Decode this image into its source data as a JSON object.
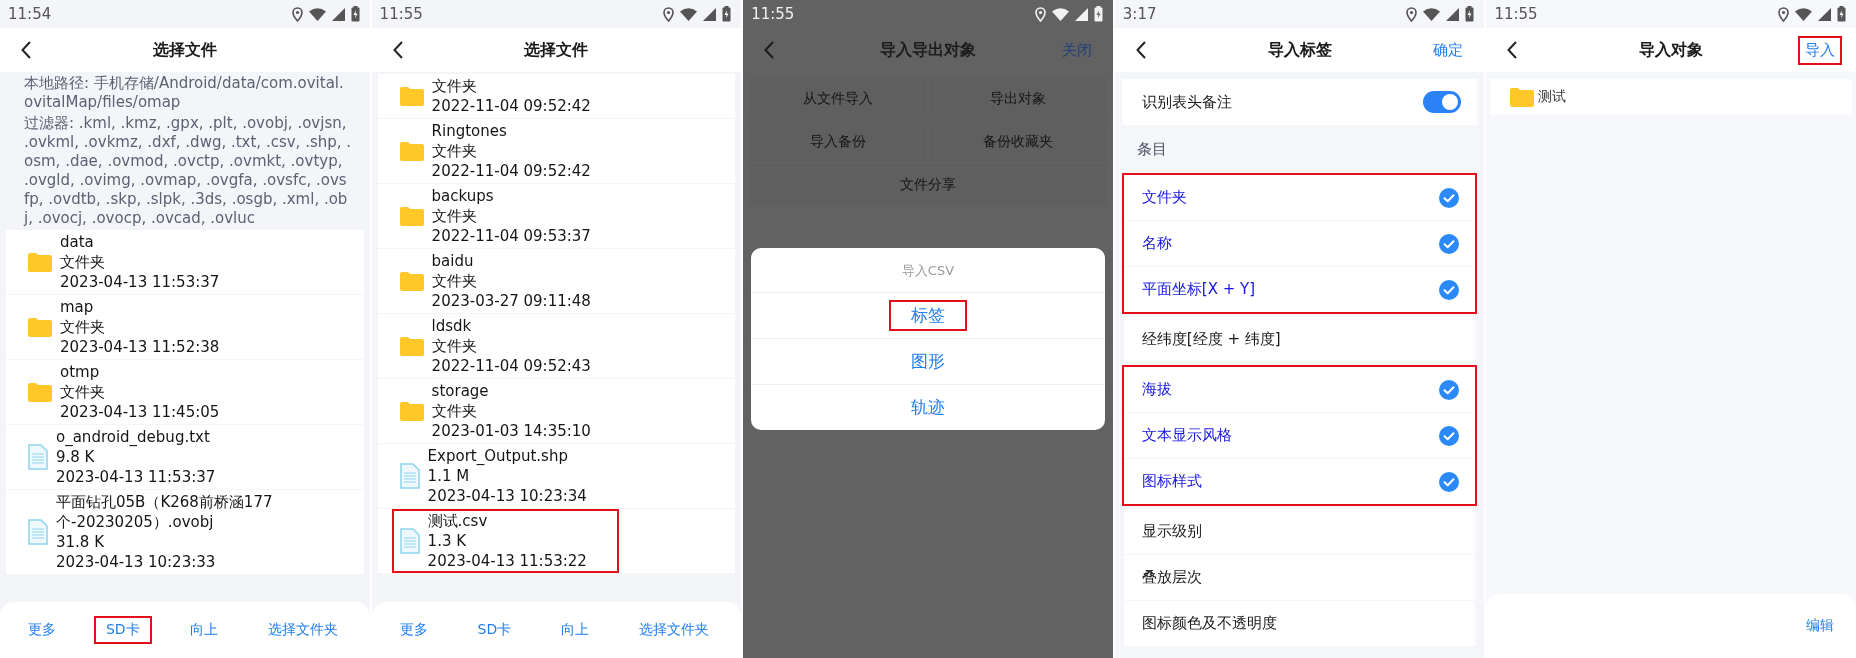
{
  "screens": [
    {
      "kind": "file_picker",
      "status_bar": {
        "time": "11:54"
      },
      "title": "选择文件",
      "path_info": "本地路径: 手机存储/Android/data/com.ovital.ovitalMap/files/omap",
      "filter_info": "过滤器: .kml, .kmz, .gpx, .plt, .ovobj, .ovjsn, .ovkml, .ovkmz, .dxf, .dwg, .txt, .csv, .shp, .osm, .dae, .ovmod, .ovctp, .ovmkt, .ovtyp, .ovgld, .ovimg, .ovmap, .ovgfa, .ovsfc, .ovsfp, .ovdtb, .skp, .slpk, .3ds, .osgb, .xml, .obj, .ovocj, .ovocp, .ovcad, .ovluc",
      "files": [
        {
          "kind": "folder",
          "name": "data",
          "detail": "文件夹",
          "date": "2023-04-13 11:53:37",
          "highlighted": false
        },
        {
          "kind": "folder",
          "name": "map",
          "detail": "文件夹",
          "date": "2023-04-13 11:52:38",
          "highlighted": false
        },
        {
          "kind": "folder",
          "name": "otmp",
          "detail": "文件夹",
          "date": "2023-04-13 11:45:05",
          "highlighted": false
        },
        {
          "kind": "file",
          "name": "o_android_debug.txt",
          "detail": "9.8 K",
          "date": "2023-04-13 11:53:37",
          "highlighted": false
        },
        {
          "kind": "file",
          "name": "平面钻孔05B（K268前桥涵177个-20230205）.ovobj",
          "detail": "31.8 K",
          "date": "2023-04-13 10:23:33",
          "highlighted": false
        }
      ],
      "toolbar": [
        {
          "label": "更多",
          "highlighted": false
        },
        {
          "label": "SD卡",
          "highlighted": true
        },
        {
          "label": "向上",
          "highlighted": false
        },
        {
          "label": "选择文件夹",
          "highlighted": false
        }
      ]
    },
    {
      "kind": "file_picker",
      "status_bar": {
        "time": "11:55"
      },
      "title": "选择文件",
      "files": [
        {
          "kind": "folder",
          "detail": "文件夹",
          "date": "2022-11-04 09:52:42",
          "highlighted": false
        },
        {
          "kind": "folder",
          "name": "Ringtones",
          "detail": "文件夹",
          "date": "2022-11-04 09:52:42",
          "highlighted": false
        },
        {
          "kind": "folder",
          "name": "backups",
          "detail": "文件夹",
          "date": "2022-11-04 09:53:37",
          "highlighted": false
        },
        {
          "kind": "folder",
          "name": "baidu",
          "detail": "文件夹",
          "date": "2023-03-27 09:11:48",
          "highlighted": false
        },
        {
          "kind": "folder",
          "name": "ldsdk",
          "detail": "文件夹",
          "date": "2022-11-04 09:52:43",
          "highlighted": false
        },
        {
          "kind": "folder",
          "name": "storage",
          "detail": "文件夹",
          "date": "2023-01-03 14:35:10",
          "highlighted": false
        },
        {
          "kind": "file",
          "name": "Export_Output.shp",
          "detail": "1.1 M",
          "date": "2023-04-13 10:23:34",
          "highlighted": false
        },
        {
          "kind": "file",
          "name": "测试.csv",
          "detail": "1.3 K",
          "date": "2023-04-13 11:53:22",
          "highlighted": true
        }
      ],
      "toolbar": [
        {
          "label": "更多",
          "highlighted": false
        },
        {
          "label": "SD卡",
          "highlighted": false
        },
        {
          "label": "向上",
          "highlighted": false
        },
        {
          "label": "选择文件夹",
          "highlighted": false
        }
      ]
    },
    {
      "kind": "action_dialog",
      "status_bar": {
        "time": "11:55"
      },
      "title": "导入导出对象",
      "close_label": "关闭",
      "actions": [
        "从文件导入",
        "导出对象",
        "导入备份",
        "备份收藏夹",
        "文件分享"
      ],
      "dialog": {
        "title": "导入CSV",
        "options": [
          {
            "label": "标签",
            "highlighted": true
          },
          {
            "label": "图形",
            "highlighted": false
          },
          {
            "label": "轨迹",
            "highlighted": false
          }
        ]
      }
    },
    {
      "kind": "field_selector",
      "status_bar": {
        "time": "3:17"
      },
      "title": "导入标签",
      "confirm_label": "确定",
      "toggle": {
        "label": "识别表头备注",
        "on": true
      },
      "section_label": "条目",
      "groups": [
        {
          "highlighted": true,
          "items": [
            {
              "label": "文件夹",
              "checked": true
            },
            {
              "label": "名称",
              "checked": true
            },
            {
              "label": "平面坐标[X + Y]",
              "checked": true
            }
          ]
        },
        {
          "highlighted": false,
          "items": [
            {
              "label": "经纬度[经度 + 纬度]",
              "checked": false
            }
          ]
        },
        {
          "highlighted": true,
          "items": [
            {
              "label": "海拔",
              "checked": true
            },
            {
              "label": "文本显示风格",
              "checked": true
            },
            {
              "label": "图标样式",
              "checked": true
            }
          ]
        },
        {
          "highlighted": false,
          "items": [
            {
              "label": "显示级别",
              "checked": false
            },
            {
              "label": "叠放层次",
              "checked": false
            },
            {
              "label": "图标颜色及不透明度",
              "checked": false
            }
          ]
        }
      ]
    },
    {
      "kind": "object_list",
      "status_bar": {
        "time": "11:55"
      },
      "title": "导入对象",
      "action": {
        "label": "导入",
        "highlighted": true
      },
      "items": [
        {
          "label": "测试"
        }
      ],
      "footer_action": "编辑"
    }
  ]
}
